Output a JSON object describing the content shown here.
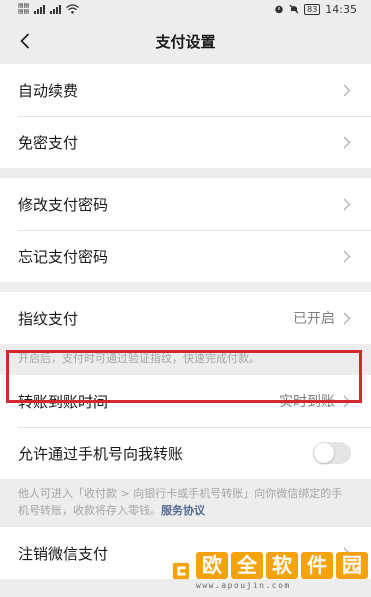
{
  "status_bar": {
    "sim1": "⁴⁶ₗ",
    "sim2": "⁴⁶ₗ",
    "battery": "83",
    "time": "14:35"
  },
  "nav": {
    "title": "支付设置"
  },
  "group1": [
    {
      "label": "自动续费"
    },
    {
      "label": "免密支付"
    }
  ],
  "group2": [
    {
      "label": "修改支付密码"
    },
    {
      "label": "忘记支付密码"
    }
  ],
  "fingerprint": {
    "label": "指纹支付",
    "value": "已开启",
    "hint": "开启后，支付时可通过验证指纹，快速完成付款。"
  },
  "transfer_time": {
    "label": "转账到账时间",
    "value": "实时到账"
  },
  "phone_transfer": {
    "label": "允许通过手机号向我转账",
    "enabled": false,
    "hint": "他人可进入「收付款 > 向银行卡或手机号转账」向你微信绑定的手机号转账，收款将存入零钱。",
    "hint_link": "服务协议"
  },
  "cancel": {
    "label": "注销微信支付"
  },
  "watermark": {
    "brand": [
      "欧",
      "全",
      "软",
      "件",
      "园"
    ],
    "url": "www.apoujin.com"
  },
  "colors": {
    "highlight": "#d6262f",
    "link": "#576b95",
    "watermark": "#f6a20a"
  }
}
